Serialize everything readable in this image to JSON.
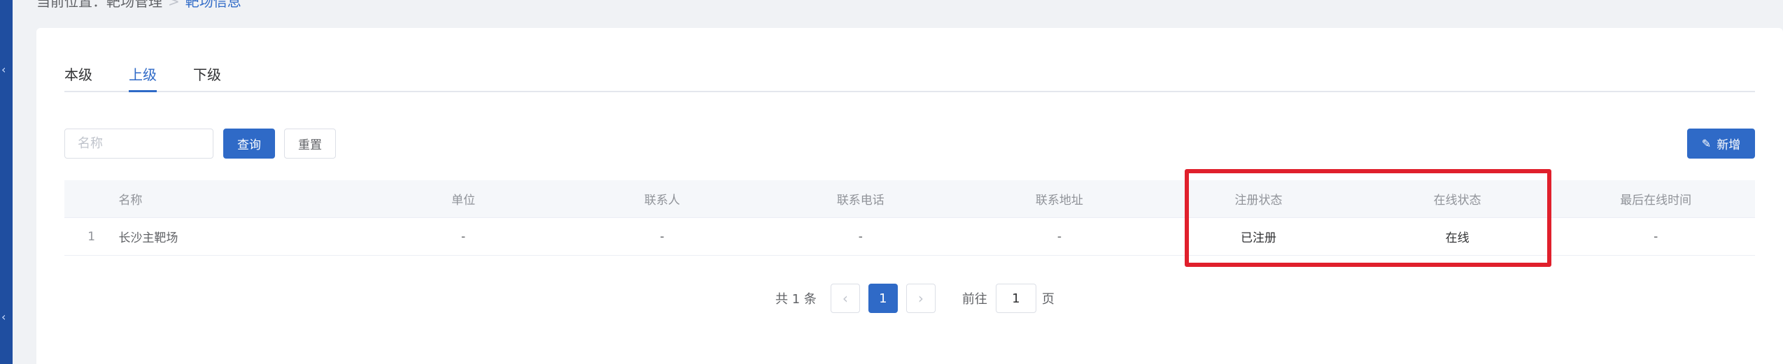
{
  "breadcrumb": {
    "prefix": "当前位置：",
    "parent": "靶场管理",
    "current": "靶场信息"
  },
  "tabs": [
    {
      "label": "本级",
      "active": false
    },
    {
      "label": "上级",
      "active": true
    },
    {
      "label": "下级",
      "active": false
    }
  ],
  "search": {
    "placeholder": "名称",
    "value": ""
  },
  "buttons": {
    "query": "查询",
    "reset": "重置",
    "add": "新增",
    "add_icon": "edit-icon"
  },
  "table": {
    "headers": {
      "name": "名称",
      "unit": "单位",
      "contact": "联系人",
      "phone": "联系电话",
      "address": "联系地址",
      "reg_status": "注册状态",
      "online_status": "在线状态",
      "last_online": "最后在线时间"
    },
    "rows": [
      {
        "index": "1",
        "name": "长沙主靶场",
        "unit": "-",
        "contact": "-",
        "phone": "-",
        "address": "-",
        "reg_status": "已注册",
        "online_status": "在线",
        "last_online": "-"
      }
    ]
  },
  "pagination": {
    "total_text": "共 1 条",
    "prev_icon": "chevron-left-icon",
    "current_page": "1",
    "next_icon": "chevron-right-icon",
    "goto_label": "前往",
    "goto_value": "1",
    "page_suffix": "页"
  },
  "colors": {
    "primary": "#2f6ac7",
    "highlight_border": "#e0202c",
    "sidebar": "#1f4ea0"
  }
}
